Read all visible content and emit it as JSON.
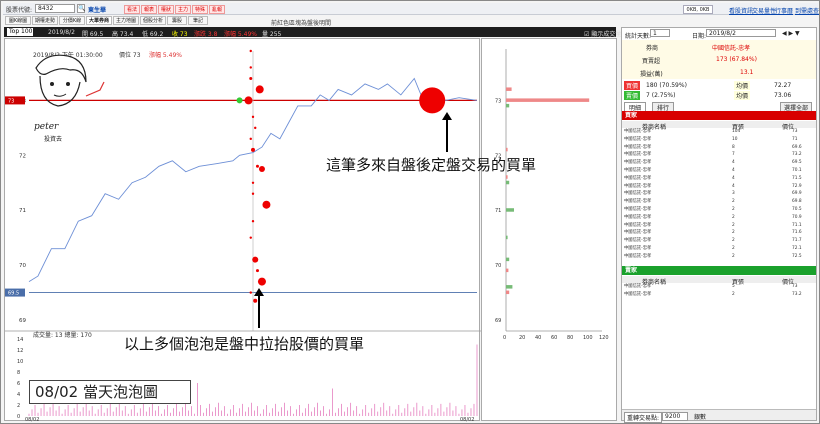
{
  "toolbar": {
    "code_label": "股票代號:",
    "code": "8432",
    "name": "東生華",
    "red_buttons": [
      "看法",
      "報表",
      "權狀",
      "主力",
      "特殊",
      "亂報"
    ],
    "right_button": "0KB, 0KB",
    "links": [
      "看股資訊",
      "交易量性",
      "行事曆",
      "到需處查"
    ]
  },
  "tabs": [
    "圖K線圖",
    "期權走勢",
    "分價K線",
    "大單券商",
    "主力地圖",
    "個股分析",
    "籌股",
    "筆記"
  ],
  "tab_center": "前紅色區塊為盤後明間",
  "dark_bar": {
    "topselect": "Top 100",
    "date": "2019/8/2",
    "items": [
      {
        "t": "開 69.5",
        "c": "#ddd"
      },
      {
        "t": "高 73.4",
        "c": "#ddd"
      },
      {
        "t": "低 69.2",
        "c": "#ddd"
      },
      {
        "t": "收 73",
        "c": "#ff0"
      },
      {
        "t": "漲跌 3.8",
        "c": "#f33"
      },
      {
        "t": "漲幅 5.49%",
        "c": "#f33"
      },
      {
        "t": "量 255",
        "c": "#ddd"
      }
    ],
    "checkbox": "顯示成交量"
  },
  "chart_header": {
    "dt": "2019/8/2 下午 01:30:00",
    "price": "價位 73",
    "pct": "漲幅 5.49%"
  },
  "annot1": "這筆多來自盤後定盤交易的買單",
  "annot2": "以上多個泡泡是盤中拉抬股價的買單",
  "annot3": "08/02 當天泡泡圖",
  "logo_name": "peter",
  "logo_sub": "投資去",
  "vol_header": "成交量: 13 總量: 170",
  "chart_data": {
    "type": "line",
    "title": "",
    "ylim": [
      68.8,
      73.9
    ],
    "yticks": [
      69,
      70,
      71,
      72,
      73
    ],
    "hlines": [
      {
        "y": 73,
        "label": "73",
        "color": "#c00"
      },
      {
        "y": 69.5,
        "label": "69.5",
        "color": "#4a6ea9"
      }
    ],
    "line": [
      [
        0,
        69.7
      ],
      [
        0.02,
        69.8
      ],
      [
        0.05,
        70.3
      ],
      [
        0.08,
        70.3
      ],
      [
        0.11,
        70.8
      ],
      [
        0.14,
        70.9
      ],
      [
        0.17,
        71.3
      ],
      [
        0.2,
        71.2
      ],
      [
        0.23,
        71.5
      ],
      [
        0.26,
        71.6
      ],
      [
        0.29,
        71.8
      ],
      [
        0.32,
        71.9
      ],
      [
        0.35,
        71.7
      ],
      [
        0.38,
        71.8
      ],
      [
        0.42,
        71.85
      ],
      [
        0.455,
        71.9
      ],
      [
        0.47,
        72
      ],
      [
        0.5,
        72.05
      ],
      [
        0.52,
        72.15
      ],
      [
        0.54,
        72.4
      ],
      [
        0.56,
        72.3
      ],
      [
        0.58,
        72.6
      ],
      [
        0.6,
        72.9
      ],
      [
        0.63,
        72.9
      ],
      [
        0.65,
        73.1
      ],
      [
        0.67,
        73.0
      ],
      [
        0.69,
        73.2
      ],
      [
        0.72,
        73.1
      ],
      [
        0.75,
        73.3
      ],
      [
        0.78,
        73.2
      ],
      [
        0.8,
        73.3
      ],
      [
        0.83,
        73.1
      ],
      [
        0.86,
        73.4
      ],
      [
        0.88,
        73.0
      ],
      [
        0.9,
        73.2
      ],
      [
        0.93,
        73.0
      ],
      [
        0.96,
        73.05
      ],
      [
        1,
        73
      ]
    ],
    "bubbles": [
      [
        0.495,
        73.9,
        1.2,
        "#e00"
      ],
      [
        0.495,
        73.6,
        1.2,
        "#e00"
      ],
      [
        0.495,
        73.4,
        1.5,
        "#e00"
      ],
      [
        0.47,
        73.0,
        3,
        "#3c3"
      ],
      [
        0.49,
        73.0,
        4,
        "#e00"
      ],
      [
        0.515,
        73.2,
        4,
        "#e00"
      ],
      [
        0.5,
        72.7,
        1.2,
        "#e00"
      ],
      [
        0.505,
        72.5,
        1.2,
        "#e00"
      ],
      [
        0.495,
        72.3,
        1.2,
        "#e00"
      ],
      [
        0.5,
        72.1,
        2,
        "#e00"
      ],
      [
        0.51,
        71.8,
        1.5,
        "#e00"
      ],
      [
        0.52,
        71.75,
        3,
        "#e00"
      ],
      [
        0.5,
        71.5,
        1.2,
        "#e00"
      ],
      [
        0.5,
        71.3,
        1.2,
        "#e00"
      ],
      [
        0.53,
        71.1,
        4,
        "#e00"
      ],
      [
        0.5,
        70.8,
        1.2,
        "#e00"
      ],
      [
        0.495,
        70.5,
        1.2,
        "#e00"
      ],
      [
        0.505,
        70.1,
        3,
        "#e00"
      ],
      [
        0.51,
        69.9,
        1.5,
        "#e00"
      ],
      [
        0.52,
        69.7,
        4,
        "#e00"
      ],
      [
        0.495,
        69.5,
        1.2,
        "#e00"
      ],
      [
        0.505,
        69.35,
        2,
        "#e00"
      ],
      [
        0.9,
        73.0,
        13,
        "#e00"
      ]
    ],
    "volume_ylim": [
      0,
      14
    ],
    "volume_yticks": [
      0,
      2,
      4,
      6,
      8,
      10,
      12,
      14
    ],
    "volume_xlabel": [
      "08/02",
      "08/02"
    ],
    "hist_ylabels": [
      73,
      72,
      71,
      70,
      69
    ],
    "hist_xticks": [
      0,
      20,
      40,
      60,
      80,
      100,
      120
    ]
  },
  "right": {
    "count_label": "統計天數:",
    "count": "1",
    "date_label": "日期:",
    "date": "2019/8/2",
    "table": [
      {
        "k": "券商",
        "v": "中國信託-忠孝",
        "vc": "#d00"
      },
      {
        "k": "買賣超",
        "v": "173 (67.84%)",
        "vc": "#d00"
      },
      {
        "k": "損益(萬)",
        "v": "13.1",
        "vc": "#d00"
      }
    ],
    "stats": [
      {
        "a": "買價",
        "b": "180 (70.59%)",
        "c": "均價",
        "d": "72.27"
      },
      {
        "a": "賣價",
        "b": "7 (2.75%)",
        "c": "均價",
        "d": "73.06"
      }
    ],
    "tabs": [
      "明細",
      "排行"
    ],
    "select_btn": "選擇全部",
    "buy_header": "買家",
    "sell_header": "賣家",
    "cols": [
      "券商名稱",
      "買張",
      "價位"
    ],
    "buys": [
      [
        "中國信託-忠孝",
        "104",
        "73"
      ],
      [
        "中國信託-忠孝",
        "10",
        "71"
      ],
      [
        "中國信託-忠孝",
        "8",
        "69.6"
      ],
      [
        "中國信託-忠孝",
        "7",
        "73.2"
      ],
      [
        "中國信託-忠孝",
        "4",
        "69.5"
      ],
      [
        "中國信託-忠孝",
        "4",
        "70.1"
      ],
      [
        "中國信託-忠孝",
        "4",
        "71.5"
      ],
      [
        "中國信託-忠孝",
        "4",
        "72.9"
      ],
      [
        "中國信託-忠孝",
        "3",
        "69.9"
      ],
      [
        "中國信託-忠孝",
        "2",
        "69.8"
      ],
      [
        "中國信託-忠孝",
        "2",
        "70.5"
      ],
      [
        "中國信託-忠孝",
        "2",
        "70.9"
      ],
      [
        "中國信託-忠孝",
        "2",
        "71.1"
      ],
      [
        "中國信託-忠孝",
        "2",
        "71.6"
      ],
      [
        "中國信託-忠孝",
        "2",
        "71.7"
      ],
      [
        "中國信託-忠孝",
        "2",
        "72.1"
      ],
      [
        "中國信託-忠孝",
        "2",
        "72.5"
      ]
    ],
    "sells": [
      [
        "中國信託-忠孝",
        "5",
        "73"
      ],
      [
        "中國信託-忠孝",
        "2",
        "73.2"
      ]
    ],
    "footer_label": "重轉交易點:",
    "footer_val": "9200",
    "footer_tail": "銀數"
  }
}
